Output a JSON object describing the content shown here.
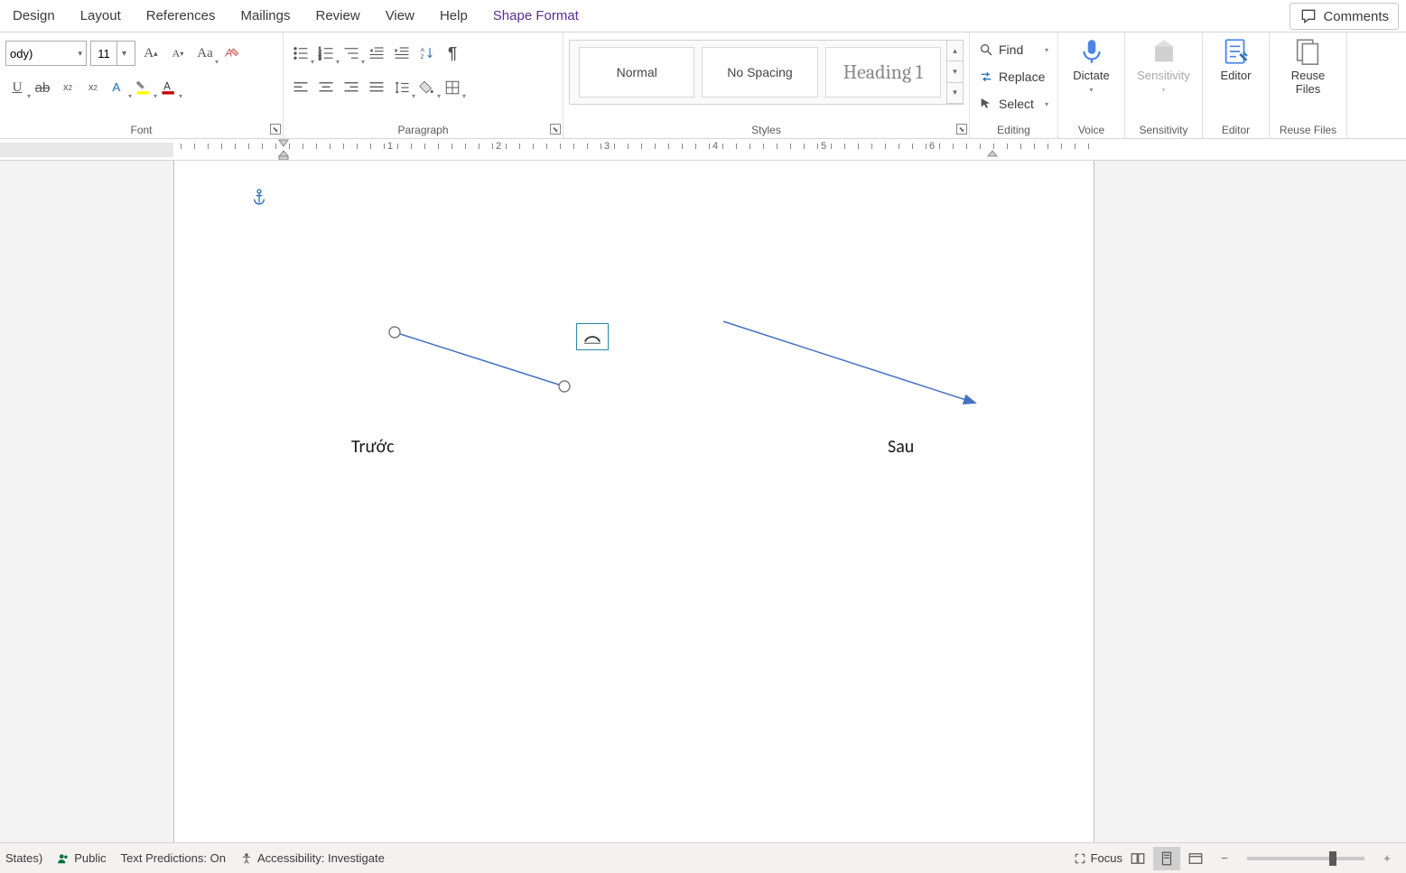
{
  "tabs": {
    "design": "Design",
    "layout": "Layout",
    "references": "References",
    "mailings": "Mailings",
    "review": "Review",
    "view": "View",
    "help": "Help",
    "shape_format": "Shape Format"
  },
  "comments_label": "Comments",
  "font": {
    "name": "ody)",
    "size": "11",
    "group_label": "Font"
  },
  "paragraph": {
    "group_label": "Paragraph"
  },
  "styles": {
    "group_label": "Styles",
    "items": [
      "Normal",
      "No Spacing",
      "Heading 1"
    ]
  },
  "editing": {
    "group_label": "Editing",
    "find": "Find",
    "replace": "Replace",
    "select": "Select"
  },
  "voice": {
    "group_label": "Voice",
    "dictate": "Dictate"
  },
  "sensitivity": {
    "group_label": "Sensitivity",
    "label": "Sensitivity"
  },
  "editor": {
    "group_label": "Editor",
    "label": "Editor"
  },
  "reuse": {
    "group_label": "Reuse Files",
    "label": "Reuse\nFiles"
  },
  "ruler": {
    "numbers": [
      "1",
      "2",
      "3",
      "4",
      "5",
      "6"
    ]
  },
  "document": {
    "caption_before": "Trước",
    "caption_after": "Sau"
  },
  "status": {
    "lang": "States)",
    "doc_class": "Public",
    "predictions": "Text Predictions: On",
    "accessibility": "Accessibility: Investigate",
    "focus": "Focus"
  }
}
